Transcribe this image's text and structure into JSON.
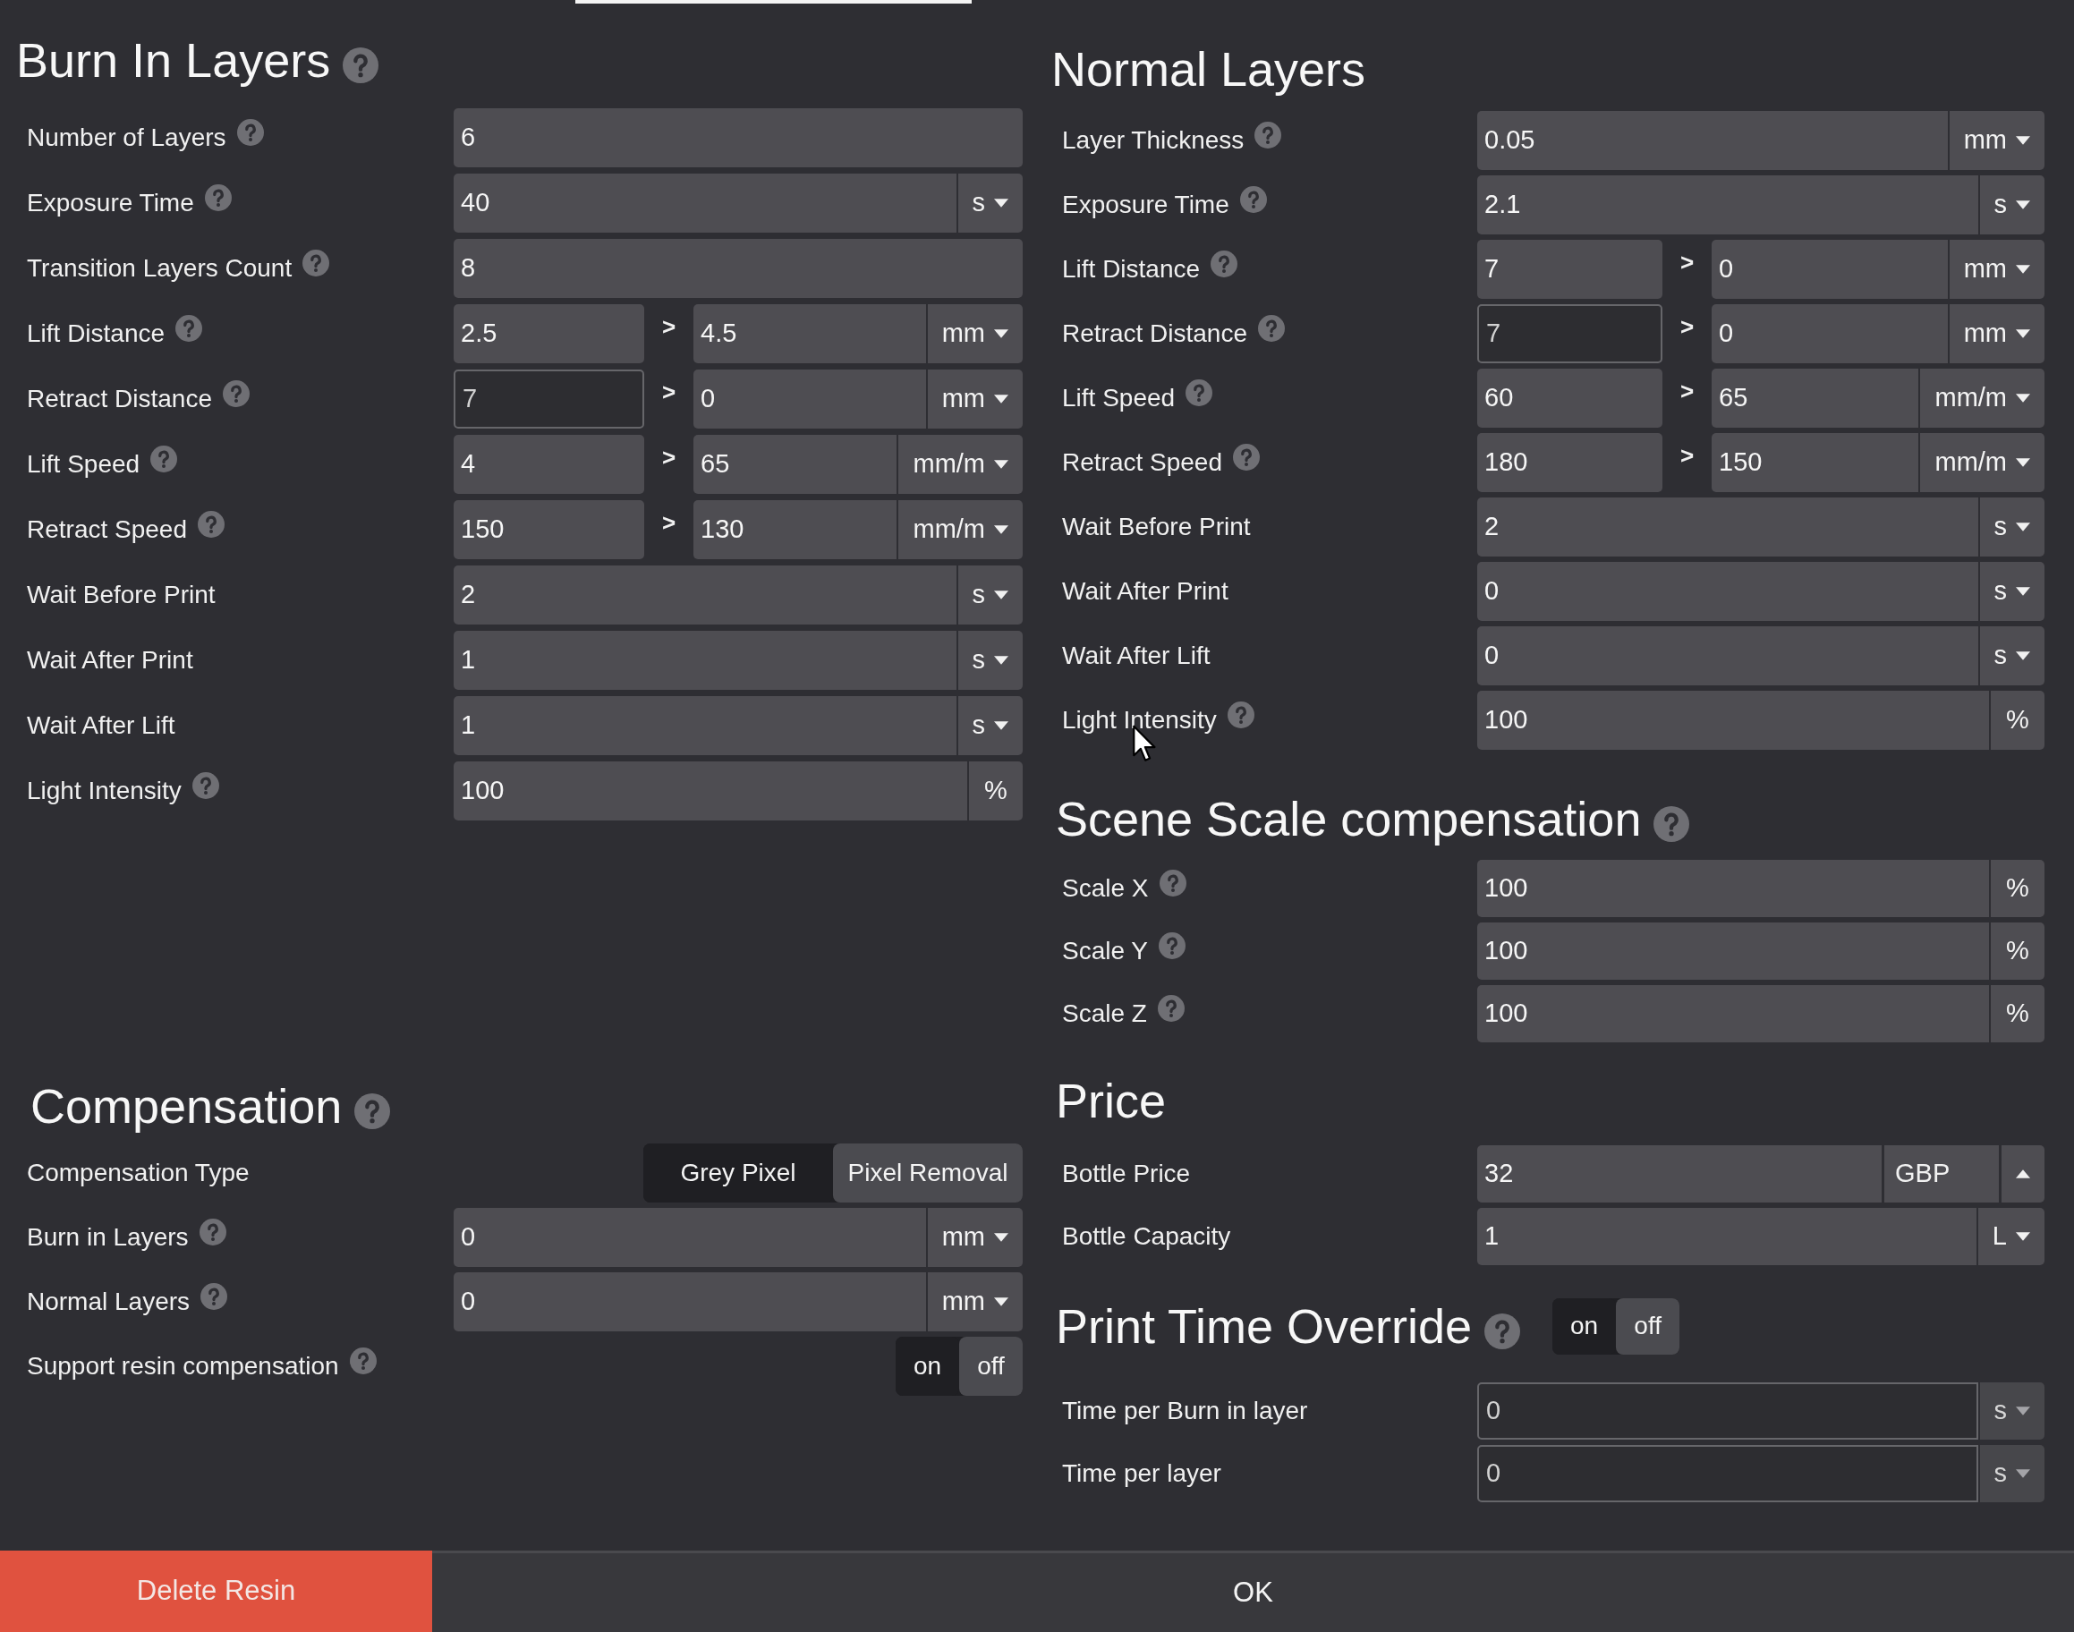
{
  "left_column": {
    "burn_in_layers": {
      "title": "Burn In Layers",
      "help": true,
      "rows": [
        {
          "kind": "number",
          "label": "Number of Layers",
          "help": true,
          "value": "6"
        },
        {
          "kind": "unit",
          "label": "Exposure Time",
          "help": true,
          "value": "40",
          "unit": "s",
          "dropdown": true
        },
        {
          "kind": "number",
          "label": "Transition Layers Count",
          "help": true,
          "value": "8"
        },
        {
          "kind": "range",
          "label": "Lift Distance",
          "help": true,
          "from": "2.5",
          "from_disabled": false,
          "separator": ">",
          "to": "4.5",
          "unit": "mm",
          "dropdown": true
        },
        {
          "kind": "range",
          "label": "Retract Distance",
          "help": true,
          "from": "7",
          "from_disabled": true,
          "separator": ">",
          "to": "0",
          "unit": "mm",
          "dropdown": true
        },
        {
          "kind": "range",
          "label": "Lift Speed",
          "help": true,
          "from": "4",
          "from_disabled": false,
          "separator": ">",
          "to": "65",
          "unit": "mm/m",
          "dropdown": true
        },
        {
          "kind": "range",
          "label": "Retract Speed",
          "help": true,
          "from": "150",
          "from_disabled": false,
          "separator": ">",
          "to": "130",
          "unit": "mm/m",
          "dropdown": true
        },
        {
          "kind": "unit",
          "label": "Wait Before Print",
          "help": false,
          "value": "2",
          "unit": "s",
          "dropdown": true
        },
        {
          "kind": "unit",
          "label": "Wait After Print",
          "help": false,
          "value": "1",
          "unit": "s",
          "dropdown": true
        },
        {
          "kind": "unit",
          "label": "Wait After Lift",
          "help": false,
          "value": "1",
          "unit": "s",
          "dropdown": true
        },
        {
          "kind": "unit",
          "label": "Light Intensity",
          "help": true,
          "value": "100",
          "unit": "%",
          "dropdown": false
        }
      ]
    },
    "compensation": {
      "title": "Compensation",
      "help": true,
      "rows": [
        {
          "kind": "segmented",
          "label": "Compensation Type",
          "help": false,
          "options": [
            {
              "label": "Grey Pixel",
              "selected": false
            },
            {
              "label": "Pixel Removal",
              "selected": true
            }
          ]
        },
        {
          "kind": "unit",
          "label": "Burn in Layers",
          "help": true,
          "value": "0",
          "unit": "mm",
          "dropdown": true
        },
        {
          "kind": "unit",
          "label": "Normal Layers",
          "help": true,
          "value": "0",
          "unit": "mm",
          "dropdown": true
        },
        {
          "kind": "switch",
          "label": "Support resin compensation",
          "help": true,
          "options": [
            {
              "label": "on",
              "selected": false
            },
            {
              "label": "off",
              "selected": true
            }
          ]
        }
      ]
    }
  },
  "right_column": {
    "normal_layers": {
      "title": "Normal Layers",
      "help": false,
      "rows": [
        {
          "kind": "unit",
          "label": "Layer Thickness",
          "help": true,
          "value": "0.05",
          "unit": "mm",
          "dropdown": true
        },
        {
          "kind": "unit",
          "label": "Exposure Time",
          "help": true,
          "value": "2.1",
          "unit": "s",
          "dropdown": true
        },
        {
          "kind": "range",
          "label": "Lift Distance",
          "help": true,
          "from": "7",
          "from_disabled": false,
          "separator": ">",
          "to": "0",
          "unit": "mm",
          "dropdown": true
        },
        {
          "kind": "range",
          "label": "Retract Distance",
          "help": true,
          "from": "7",
          "from_disabled": true,
          "separator": ">",
          "to": "0",
          "unit": "mm",
          "dropdown": true
        },
        {
          "kind": "range",
          "label": "Lift Speed",
          "help": true,
          "from": "60",
          "from_disabled": false,
          "separator": ">",
          "to": "65",
          "unit": "mm/m",
          "dropdown": true
        },
        {
          "kind": "range",
          "label": "Retract Speed",
          "help": true,
          "from": "180",
          "from_disabled": false,
          "separator": ">",
          "to": "150",
          "unit": "mm/m",
          "dropdown": true
        },
        {
          "kind": "unit",
          "label": "Wait Before Print",
          "help": false,
          "value": "2",
          "unit": "s",
          "dropdown": true
        },
        {
          "kind": "unit",
          "label": "Wait After Print",
          "help": false,
          "value": "0",
          "unit": "s",
          "dropdown": true
        },
        {
          "kind": "unit",
          "label": "Wait After Lift",
          "help": false,
          "value": "0",
          "unit": "s",
          "dropdown": true
        },
        {
          "kind": "unit",
          "label": "Light Intensity",
          "help": true,
          "value": "100",
          "unit": "%",
          "dropdown": false
        }
      ]
    },
    "scene_scale_compensation": {
      "title": "Scene Scale compensation",
      "help": true,
      "rows": [
        {
          "kind": "unit",
          "label": "Scale X",
          "help": true,
          "value": "100",
          "unit": "%",
          "dropdown": false
        },
        {
          "kind": "unit",
          "label": "Scale Y",
          "help": true,
          "value": "100",
          "unit": "%",
          "dropdown": false
        },
        {
          "kind": "unit",
          "label": "Scale Z",
          "help": true,
          "value": "100",
          "unit": "%",
          "dropdown": false
        }
      ]
    },
    "price": {
      "title": "Price",
      "help": false,
      "rows": [
        {
          "kind": "currency",
          "label": "Bottle Price",
          "help": false,
          "value": "32",
          "unit": "GBP"
        },
        {
          "kind": "unit",
          "label": "Bottle Capacity",
          "help": false,
          "value": "1",
          "unit": "L",
          "dropdown": true
        }
      ]
    },
    "print_time_override": {
      "title": "Print Time Override",
      "help": true,
      "toggle": [
        {
          "label": "on",
          "selected": false
        },
        {
          "label": "off",
          "selected": true
        }
      ],
      "rows": [
        {
          "kind": "unit",
          "label": "Time per Burn in layer",
          "help": false,
          "value": "0",
          "unit": "s",
          "dropdown": true,
          "disabled": true
        },
        {
          "kind": "unit",
          "label": "Time per layer",
          "help": false,
          "value": "0",
          "unit": "s",
          "dropdown": true,
          "disabled": true
        }
      ]
    }
  },
  "footer": {
    "delete_button": "Delete Resin",
    "ok_button": "OK"
  }
}
